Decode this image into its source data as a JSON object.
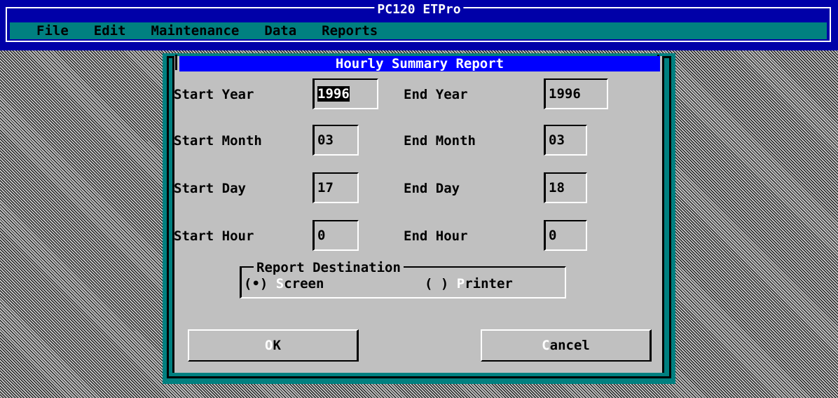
{
  "app": {
    "title": "PC120 ETPro",
    "menu": [
      "File",
      "Edit",
      "Maintenance",
      "Data",
      "Reports"
    ]
  },
  "dialog": {
    "title": "Hourly Summary Report",
    "fields": {
      "start_year": {
        "label": "Start Year",
        "value": "1996"
      },
      "end_year": {
        "label": "End Year",
        "value": "1996"
      },
      "start_month": {
        "label": "Start Month",
        "value": "03"
      },
      "end_month": {
        "label": "End Month",
        "value": "03"
      },
      "start_day": {
        "label": "Start Day",
        "value": "17"
      },
      "end_day": {
        "label": "End Day",
        "value": "18"
      },
      "start_hour": {
        "label": "Start Hour",
        "value": "0"
      },
      "end_hour": {
        "label": "End Hour",
        "value": "0"
      }
    },
    "destination": {
      "title": "Report Destination",
      "screen": {
        "mark": "(•)",
        "hotkey": "S",
        "rest": "creen",
        "selected": true
      },
      "printer": {
        "mark": "( )",
        "hotkey": "P",
        "rest": "rinter",
        "selected": false
      }
    },
    "buttons": {
      "ok": {
        "hotkey": "O",
        "rest": "K"
      },
      "cancel": {
        "hotkey": "C",
        "rest": "ancel"
      }
    }
  },
  "colors": {
    "app_frame": "#0000a8",
    "menubar": "#008080",
    "dialog_title": "#0000ff",
    "dialog_face": "#c0c0c0"
  }
}
